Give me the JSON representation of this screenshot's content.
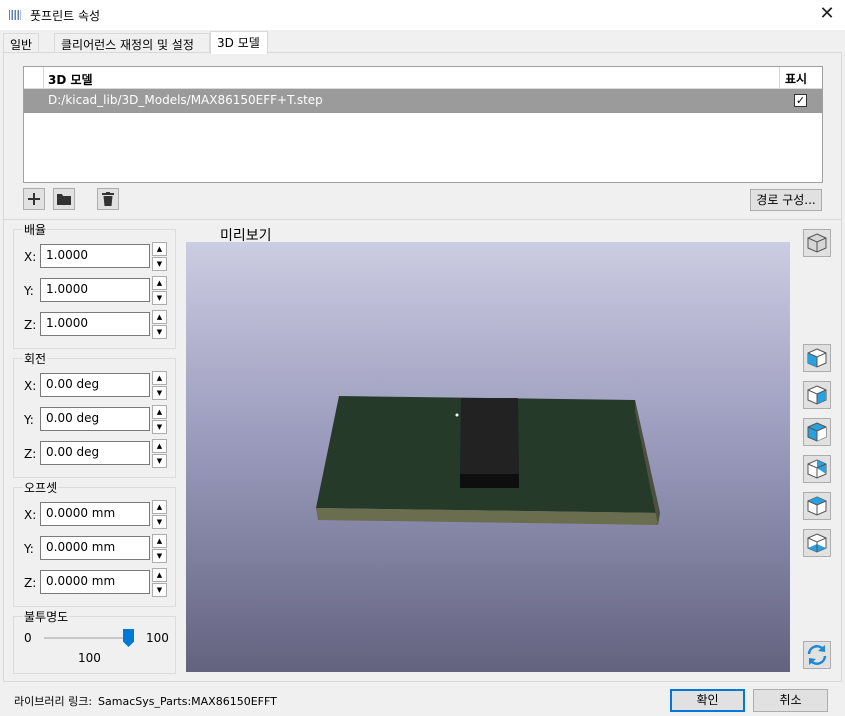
{
  "window": {
    "title": "풋프린트 속성",
    "close_label": "✕"
  },
  "tabs": [
    {
      "label": "일반"
    },
    {
      "label": "클리어런스 재정의 및 설정"
    },
    {
      "label": "3D 모델"
    }
  ],
  "model_table": {
    "col_model": "3D 모델",
    "col_show": "표시",
    "rows": [
      {
        "path": "D:/kicad_lib/3D_Models/MAX86150EFF+T.step",
        "show": true
      }
    ]
  },
  "toolbar": {
    "add_icon": "plus-icon",
    "folder_icon": "folder-icon",
    "delete_icon": "trash-icon",
    "path_config_label": "경로 구성..."
  },
  "scale": {
    "title": "배율",
    "fields": [
      {
        "label": "X:",
        "value": "1.0000"
      },
      {
        "label": "Y:",
        "value": "1.0000"
      },
      {
        "label": "Z:",
        "value": "1.0000"
      }
    ]
  },
  "rotation": {
    "title": "회전",
    "fields": [
      {
        "label": "X:",
        "value": "0.00 deg"
      },
      {
        "label": "Y:",
        "value": "0.00 deg"
      },
      {
        "label": "Z:",
        "value": "0.00 deg"
      }
    ]
  },
  "offset": {
    "title": "오프셋",
    "fields": [
      {
        "label": "X:",
        "value": "0.0000 mm"
      },
      {
        "label": "Y:",
        "value": "0.0000 mm"
      },
      {
        "label": "Z:",
        "value": "0.0000 mm"
      }
    ]
  },
  "opacity": {
    "title": "불투명도",
    "min_label": "0",
    "max_label": "100",
    "value_label": "100",
    "value": 100
  },
  "preview": {
    "label": "미리보기",
    "colors": {
      "board_top": "#253a29",
      "board_side": "#6a6e4e",
      "chip": "#1e1e1e"
    }
  },
  "view_buttons": [
    "cube-3d-icon",
    "view-left-icon",
    "view-right-icon",
    "view-front-icon",
    "view-back-icon",
    "view-top-icon",
    "view-bottom-icon",
    "reload-icon"
  ],
  "footer": {
    "lib_label": "라이브러리 링크:",
    "lib_value": "SamacSys_Parts:MAX86150EFFT",
    "ok_label": "확인",
    "cancel_label": "취소"
  },
  "accent_color": "#0078d7"
}
